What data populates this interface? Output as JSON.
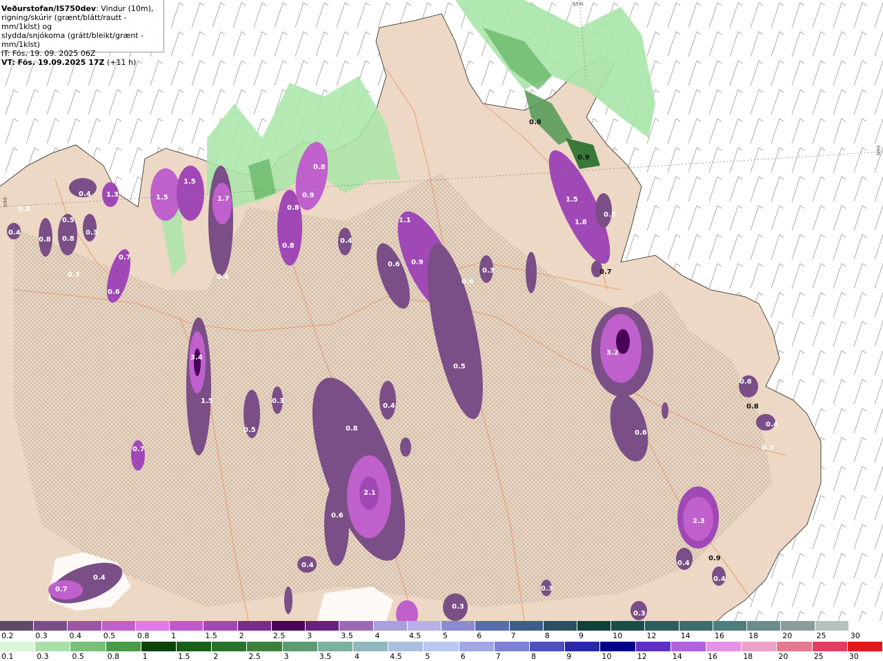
{
  "info": {
    "source": "Veðurstofan/IS750dev",
    "description_1": ": Vindur (10m),",
    "description_2": "rigning/skúrir (grænt/blátt/rautt - mm/1klst) og",
    "description_3": "slydda/snjókoma (grátt/bleikt/grænt - mm/1klst)",
    "it_line": "IT: Fös. 19. 09. 2025 06Z",
    "vt_line_bold": "VT: Fös. 19.09.2025 17Z",
    "vt_line_extra": " (+11 h)"
  },
  "map": {
    "gridlabels": {
      "top": "15W",
      "left": "N99",
      "right": "N99"
    },
    "value_labels": [
      {
        "text": "0.4"
      },
      {
        "text": "1.3"
      },
      {
        "text": "0.5"
      },
      {
        "text": "0.4"
      },
      {
        "text": "0.8"
      },
      {
        "text": "0.3"
      },
      {
        "text": "0.8"
      },
      {
        "text": "0.3"
      },
      {
        "text": "0.7"
      },
      {
        "text": "0.3"
      },
      {
        "text": "0.6"
      },
      {
        "text": "1.5"
      },
      {
        "text": "1.5"
      },
      {
        "text": "1.7"
      },
      {
        "text": "0.4"
      },
      {
        "text": "0.8"
      },
      {
        "text": "0.9"
      },
      {
        "text": "0.8"
      },
      {
        "text": "0.8"
      },
      {
        "text": "0.4"
      },
      {
        "text": "1.1"
      },
      {
        "text": "0.6"
      },
      {
        "text": "0.9"
      },
      {
        "text": "0.6"
      },
      {
        "text": "0.3"
      },
      {
        "text": "3.4"
      },
      {
        "text": "1.5"
      },
      {
        "text": "0.3"
      },
      {
        "text": "0.5"
      },
      {
        "text": "0.7"
      },
      {
        "text": "0.8"
      },
      {
        "text": "0.4"
      },
      {
        "text": "0.5"
      },
      {
        "text": "2.1"
      },
      {
        "text": "0.6"
      },
      {
        "text": "0.4"
      },
      {
        "text": "0.8"
      },
      {
        "text": "0.9"
      },
      {
        "text": "1.5"
      },
      {
        "text": "1.8"
      },
      {
        "text": "0.5"
      },
      {
        "text": "0.7"
      },
      {
        "text": "3.2"
      },
      {
        "text": "0.6"
      },
      {
        "text": "2.3"
      },
      {
        "text": "0.9"
      },
      {
        "text": "0.4"
      },
      {
        "text": "0.4"
      },
      {
        "text": "0.7"
      },
      {
        "text": "0.4"
      },
      {
        "text": "0.3"
      },
      {
        "text": "0.3"
      },
      {
        "text": "0.3"
      },
      {
        "text": "0.6"
      },
      {
        "text": "0.8"
      },
      {
        "text": "0.4"
      },
      {
        "text": "0.3"
      }
    ]
  },
  "legend_snow": {
    "labels": [
      "0.2",
      "0.3",
      "0.4",
      "0.5",
      "0.8",
      "1",
      "1.5",
      "2",
      "2.5",
      "3",
      "3.5",
      "4",
      "4.5",
      "5",
      "6",
      "7",
      "8",
      "9",
      "10",
      "12",
      "14",
      "16",
      "18",
      "20",
      "25",
      "30"
    ],
    "colors": [
      "#5e4a66",
      "#7a4e86",
      "#9a55a8",
      "#c060cc",
      "#e079ea",
      "#c058d0",
      "#a048b6",
      "#7a2a8c",
      "#4a0058",
      "#6a2080",
      "#9a6ab4",
      "#a8a0dc",
      "#b8b0e8",
      "#8a8ad0",
      "#5a6cb0",
      "#3c5c8c",
      "#2c5060",
      "#10403a",
      "#1c4c48",
      "#2c5c5c",
      "#3c6c6c",
      "#4c7c7c",
      "#6c8c8c",
      "#8c9c9c",
      "#b8c0c0",
      "#ffffff"
    ]
  },
  "legend_rain": {
    "labels": [
      "0.1",
      "0.3",
      "0.5",
      "0.8",
      "1",
      "1.5",
      "2",
      "2.5",
      "3",
      "3.5",
      "4",
      "4.5",
      "5",
      "6",
      "7",
      "8",
      "9",
      "10",
      "12",
      "14",
      "16",
      "18",
      "20",
      "25",
      "30"
    ],
    "colors": [
      "#d8f8d8",
      "#a8e0a8",
      "#78c078",
      "#489c48",
      "#0c440c",
      "#186018",
      "#287428",
      "#3c803c",
      "#5c9c74",
      "#7cb0a0",
      "#90b8c0",
      "#a8c0e0",
      "#b8c8f0",
      "#a0a8e8",
      "#7c80d8",
      "#5050c0",
      "#2828a8",
      "#00008c",
      "#6030c0",
      "#b060e0",
      "#e890e8",
      "#f0a0c8",
      "#e87890",
      "#e04060",
      "#e01818"
    ]
  }
}
